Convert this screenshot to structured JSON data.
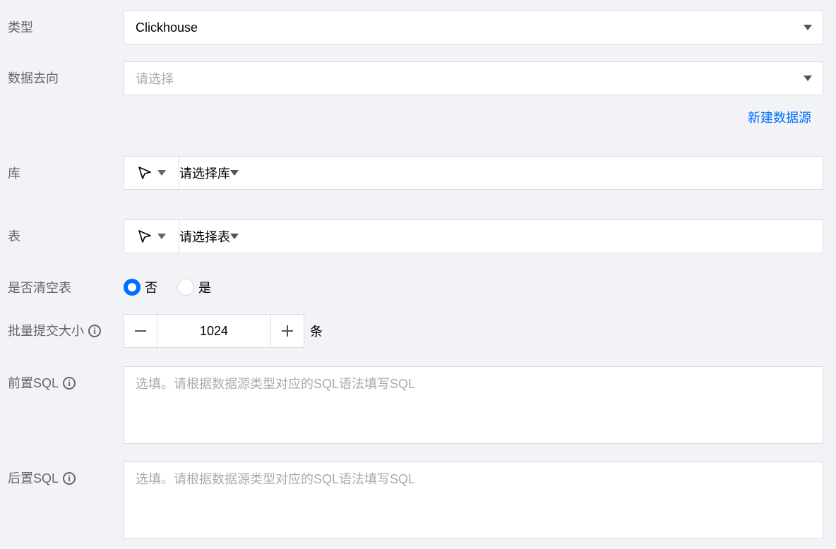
{
  "type_field": {
    "label": "类型",
    "value": "Clickhouse"
  },
  "destination_field": {
    "label": "数据去向",
    "placeholder": "请选择",
    "new_source_link": "新建数据源"
  },
  "database_field": {
    "label": "库",
    "placeholder": "请选择库"
  },
  "table_field": {
    "label": "表",
    "placeholder": "请选择表"
  },
  "truncate_field": {
    "label": "是否清空表",
    "options": [
      "否",
      "是"
    ],
    "selected": "否"
  },
  "batch_field": {
    "label": "批量提交大小",
    "value": "1024",
    "unit": "条"
  },
  "pre_sql_field": {
    "label": "前置SQL",
    "placeholder": "选填。请根据数据源类型对应的SQL语法填写SQL"
  },
  "post_sql_field": {
    "label": "后置SQL",
    "placeholder": "选填。请根据数据源类型对应的SQL语法填写SQL"
  },
  "colors": {
    "accent": "#006eff",
    "label": "#666666",
    "border": "#dcdcdc",
    "background": "#f2f3f7"
  }
}
